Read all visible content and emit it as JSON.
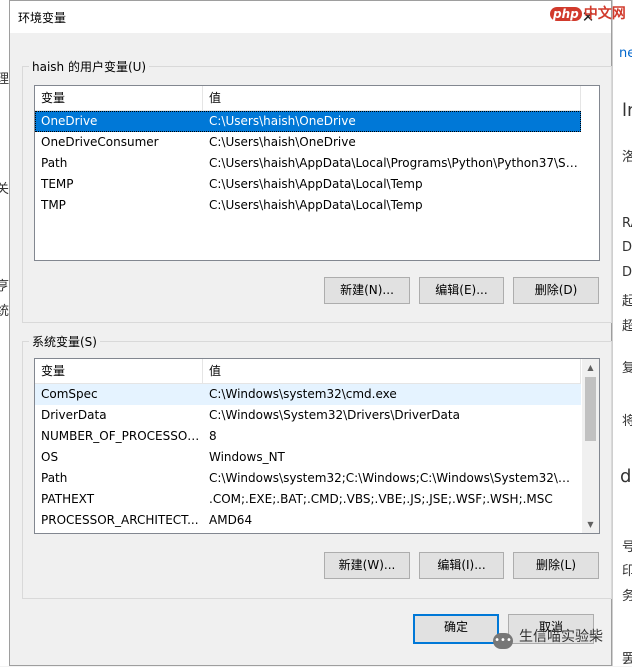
{
  "window": {
    "title": "环境变量",
    "close_glyph": "✕"
  },
  "watermark": {
    "php": "php",
    "text": "中文网"
  },
  "background_fragments": [
    "ne",
    "ln",
    "洛",
    "RA",
    "D",
    "D",
    "起",
    "超",
    "复",
    "将",
    "d",
    "号",
    "印",
    "务",
    "罢",
    "关",
    "亨",
    "统",
    "理"
  ],
  "user_section": {
    "legend": "haish 的用户变量(U)",
    "columns": [
      "变量",
      "值"
    ],
    "rows": [
      {
        "name": "OneDrive",
        "value": "C:\\Users\\haish\\OneDrive",
        "selected": true
      },
      {
        "name": "OneDriveConsumer",
        "value": "C:\\Users\\haish\\OneDrive"
      },
      {
        "name": "Path",
        "value": "C:\\Users\\haish\\AppData\\Local\\Programs\\Python\\Python37\\Sc..."
      },
      {
        "name": "TEMP",
        "value": "C:\\Users\\haish\\AppData\\Local\\Temp"
      },
      {
        "name": "TMP",
        "value": "C:\\Users\\haish\\AppData\\Local\\Temp"
      }
    ],
    "buttons": {
      "new": "新建(N)...",
      "edit": "编辑(E)...",
      "delete": "删除(D)"
    }
  },
  "system_section": {
    "legend": "系统变量(S)",
    "columns": [
      "变量",
      "值"
    ],
    "rows": [
      {
        "name": "ComSpec",
        "value": "C:\\Windows\\system32\\cmd.exe",
        "hover": true
      },
      {
        "name": "DriverData",
        "value": "C:\\Windows\\System32\\Drivers\\DriverData"
      },
      {
        "name": "NUMBER_OF_PROCESSORS",
        "value": "8"
      },
      {
        "name": "OS",
        "value": "Windows_NT"
      },
      {
        "name": "Path",
        "value": "C:\\Windows\\system32;C:\\Windows;C:\\Windows\\System32\\Wb..."
      },
      {
        "name": "PATHEXT",
        "value": ".COM;.EXE;.BAT;.CMD;.VBS;.VBE;.JS;.JSE;.WSF;.WSH;.MSC"
      },
      {
        "name": "PROCESSOR_ARCHITECT...",
        "value": "AMD64"
      }
    ],
    "buttons": {
      "new": "新建(W)...",
      "edit": "编辑(I)...",
      "delete": "删除(L)"
    }
  },
  "footer": {
    "ok": "确定",
    "cancel": "取消",
    "wechat_text": "生信喵实验柴"
  }
}
